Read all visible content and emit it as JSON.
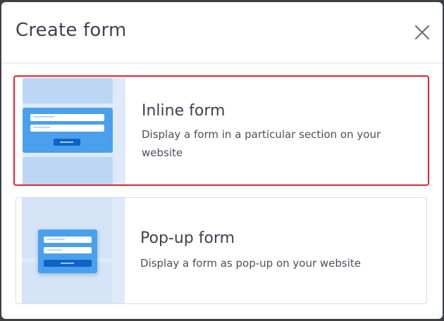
{
  "dialog": {
    "title": "Create form",
    "close_icon": "close-icon"
  },
  "options": [
    {
      "title": "Inline form",
      "description": "Display a form in a particular section on your website",
      "selected": true,
      "thumbnail_icon": "inline-form-illustration"
    },
    {
      "title": "Pop-up form",
      "description": "Display a form as pop-up on your website",
      "selected": false,
      "thumbnail_icon": "popup-form-illustration"
    }
  ],
  "colors": {
    "selection_border": "#e0262e",
    "illustration_primary": "#4aa0ec",
    "illustration_button": "#0f63c5"
  }
}
